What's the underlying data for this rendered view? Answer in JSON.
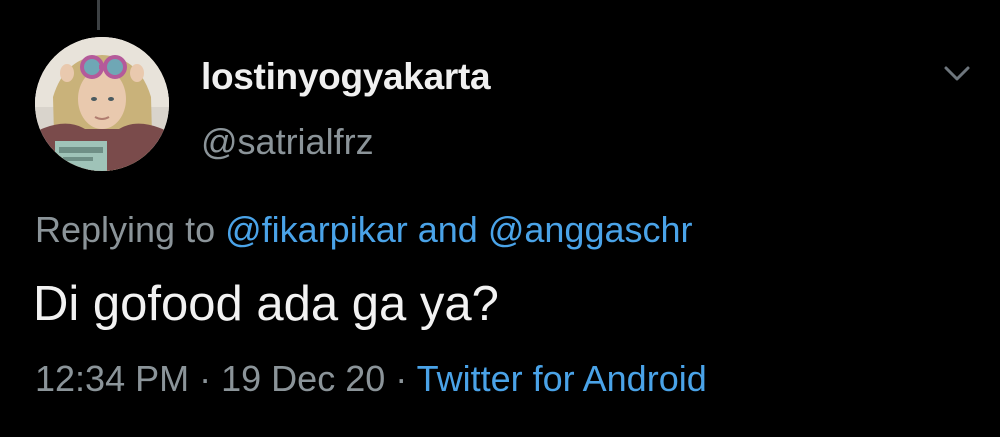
{
  "tweet": {
    "display_name": "lostinyogyakarta",
    "handle": "@satrialfrz",
    "reply": {
      "prefix": "Replying to",
      "mention_1": "@fikarpikar",
      "joiner": "and",
      "mention_2": "@anggaschr"
    },
    "text": "Di gofood ada ga ya?",
    "time": "12:34 PM",
    "separator": "·",
    "date": "19 Dec 20",
    "source": "Twitter for Android"
  },
  "icons": {
    "more": "chevron-down-icon",
    "avatar": "profile-photo"
  },
  "colors": {
    "background": "#000000",
    "text": "#e7e9ea",
    "secondary": "#8b9499",
    "link": "#4aa3e8"
  }
}
